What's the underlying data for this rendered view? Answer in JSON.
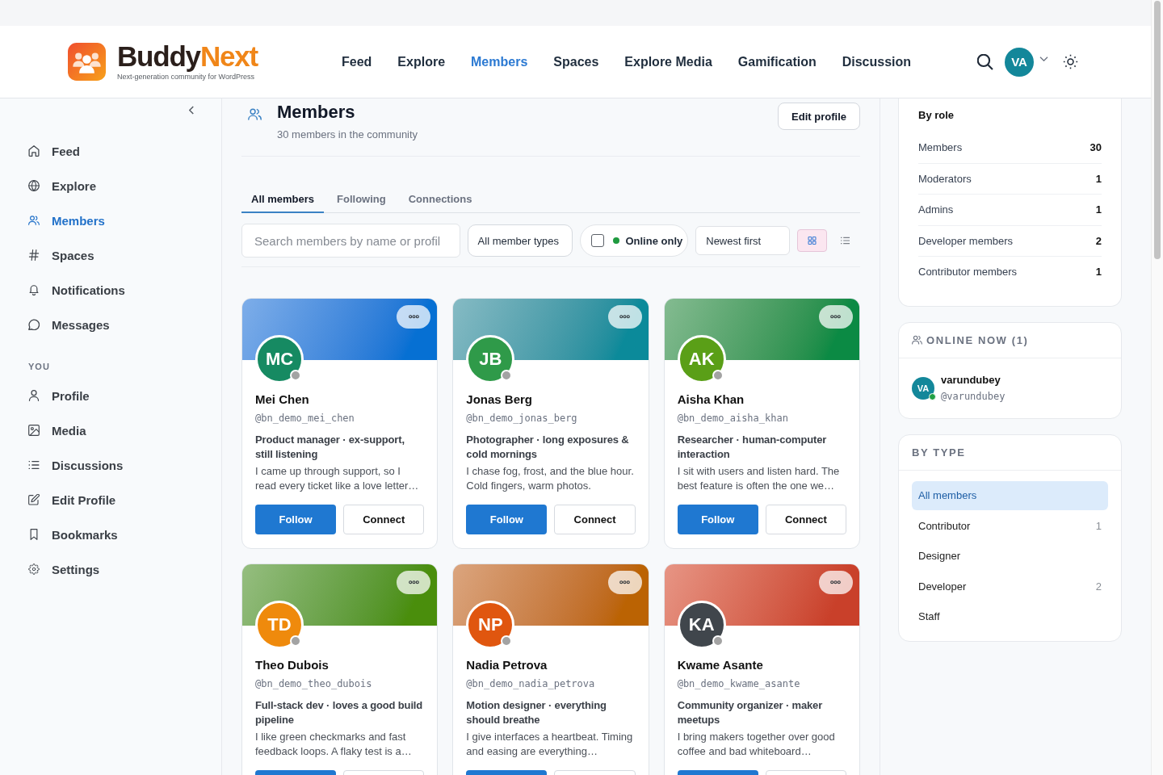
{
  "header": {
    "brand": [
      "Buddy",
      "Next"
    ],
    "tagline": "Next-generation community for WordPress",
    "nav": [
      {
        "label": "Feed",
        "selected": false
      },
      {
        "label": "Explore",
        "selected": false
      },
      {
        "label": "Members",
        "selected": true
      },
      {
        "label": "Spaces",
        "selected": false
      },
      {
        "label": "Explore Media",
        "selected": false
      },
      {
        "label": "Gamification",
        "selected": false
      },
      {
        "label": "Discussion",
        "selected": false
      }
    ],
    "user_initials": "VA"
  },
  "sidebar": {
    "groups": [
      {
        "items": [
          {
            "label": "Feed",
            "selected": false
          },
          {
            "label": "Explore",
            "selected": false
          },
          {
            "label": "Members",
            "selected": true
          },
          {
            "label": "Spaces",
            "selected": false
          },
          {
            "label": "Notifications",
            "selected": false
          },
          {
            "label": "Messages",
            "selected": false
          }
        ]
      },
      {
        "heading": "YOU",
        "items": [
          {
            "label": "Profile",
            "selected": false
          },
          {
            "label": "Media",
            "selected": false
          },
          {
            "label": "Discussions",
            "selected": false
          },
          {
            "label": "Edit Profile",
            "selected": false
          },
          {
            "label": "Bookmarks",
            "selected": false
          },
          {
            "label": "Settings",
            "selected": false
          }
        ]
      }
    ]
  },
  "page": {
    "title": "Members",
    "subtitle": "30 members in the community",
    "edit_button": "Edit profile"
  },
  "tabs": [
    {
      "label": "All members",
      "selected": true
    },
    {
      "label": "Following",
      "selected": false
    },
    {
      "label": "Connections",
      "selected": false
    }
  ],
  "filters": {
    "search": {
      "placeholder": "Search members by name or profil"
    },
    "member_type": {
      "value": "All member types"
    },
    "online_only": {
      "label": "Online only",
      "checked": false
    },
    "sort": {
      "value": "Newest first"
    },
    "view_modes": [
      {
        "kind": "grid",
        "selected": true
      },
      {
        "kind": "list",
        "selected": false
      }
    ]
  },
  "members": [
    {
      "initials": "MC",
      "name": "Mei Chen",
      "handle": "@bn_demo_mei_chen",
      "tagline": "Product manager · ex-support, still listening",
      "bio": "I came up through support, so I read every ticket like a love letter…",
      "color": "#168a62",
      "cover": {
        "color": "#0670d3"
      },
      "online": false,
      "actions": [
        {
          "kind": "primary",
          "label": "Follow"
        },
        {
          "kind": "secondary",
          "label": "Connect"
        }
      ]
    },
    {
      "initials": "JB",
      "name": "Jonas Berg",
      "handle": "@bn_demo_jonas_berg",
      "tagline": "Photographer · long exposures & cold mornings",
      "bio": "I chase fog, frost, and the blue hour. Cold fingers, warm photos.",
      "color": "#2f9a49",
      "cover": {
        "color": "#0b8a9a"
      },
      "online": false,
      "actions": [
        {
          "kind": "primary",
          "label": "Follow"
        },
        {
          "kind": "secondary",
          "label": "Connect"
        }
      ]
    },
    {
      "initials": "AK",
      "name": "Aisha Khan",
      "handle": "@bn_demo_aisha_khan",
      "tagline": "Researcher · human-computer interaction",
      "bio": "I sit with users and listen hard. The best feature is often the one we…",
      "color": "#5a9f17",
      "cover": {
        "color": "#0b8a44"
      },
      "online": false,
      "actions": [
        {
          "kind": "primary",
          "label": "Follow"
        },
        {
          "kind": "secondary",
          "label": "Connect"
        }
      ]
    },
    {
      "initials": "TD",
      "name": "Theo Dubois",
      "handle": "@bn_demo_theo_dubois",
      "tagline": "Full-stack dev · loves a good build pipeline",
      "bio": "I like green checkmarks and fast feedback loops. A flaky test is a…",
      "color": "#ef8a0c",
      "cover": {
        "color": "#4a8e0c"
      },
      "online": false,
      "actions": [
        {
          "kind": "primary"
        },
        {
          "kind": "secondary"
        }
      ]
    },
    {
      "initials": "NP",
      "name": "Nadia Petrova",
      "handle": "@bn_demo_nadia_petrova",
      "tagline": "Motion designer · everything should breathe",
      "bio": "I give interfaces a heartbeat. Timing and easing are everything…",
      "color": "#e0560f",
      "cover": {
        "color": "#bb6303"
      },
      "online": false,
      "actions": [
        {
          "kind": "primary"
        },
        {
          "kind": "secondary"
        }
      ]
    },
    {
      "initials": "KA",
      "name": "Kwame Asante",
      "handle": "@bn_demo_kwame_asante",
      "tagline": "Community organizer · maker meetups",
      "bio": "I bring makers together over good coffee and bad whiteboard…",
      "color": "#40464c",
      "cover": {
        "color": "#c9402a"
      },
      "online": false,
      "actions": [
        {
          "kind": "primary"
        },
        {
          "kind": "secondary"
        }
      ]
    }
  ],
  "role_counts": {
    "title": "By role",
    "rows": [
      {
        "label": "Members",
        "count": "30"
      },
      {
        "label": "Moderators",
        "count": "1"
      },
      {
        "label": "Admins",
        "count": "1"
      },
      {
        "label": "Developer members",
        "count": "2"
      },
      {
        "label": "Contributor members",
        "count": "1"
      }
    ]
  },
  "online_now": {
    "title": "ONLINE NOW (1)",
    "users": [
      {
        "initials": "VA",
        "name": "varundubey",
        "handle": "@varundubey",
        "online": true
      }
    ]
  },
  "by_type": {
    "title": "BY TYPE",
    "items": [
      {
        "label": "All members",
        "selected": true
      },
      {
        "label": "Contributor",
        "count": "1",
        "selected": false
      },
      {
        "label": "Designer",
        "selected": false
      },
      {
        "label": "Developer",
        "count": "2",
        "selected": false
      },
      {
        "label": "Staff",
        "selected": false
      }
    ]
  }
}
